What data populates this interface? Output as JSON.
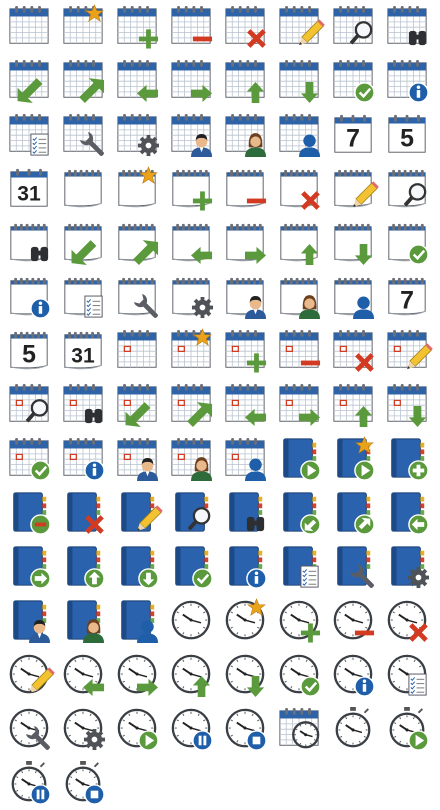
{
  "sheet": {
    "columns": 8,
    "colors": {
      "calendar_header": "#2f63a8",
      "grid_line": "#b8c2cf",
      "outline": "#5a5f66",
      "green": "#5b9a3c",
      "red": "#d23a22",
      "orange": "#e9a21a",
      "blue": "#1f5ea8",
      "book_blue": "#2a62ad",
      "clock_face": "#ffffff",
      "clock_ring": "#3a3f45"
    },
    "icons": [
      {
        "base": "cal-grid",
        "overlay": ""
      },
      {
        "base": "cal-grid",
        "overlay": "star"
      },
      {
        "base": "cal-grid",
        "overlay": "plus"
      },
      {
        "base": "cal-grid",
        "overlay": "minus"
      },
      {
        "base": "cal-grid",
        "overlay": "x"
      },
      {
        "base": "cal-grid",
        "overlay": "pencil"
      },
      {
        "base": "cal-grid",
        "overlay": "magnifier"
      },
      {
        "base": "cal-grid",
        "overlay": "binoculars"
      },
      {
        "base": "cal-grid",
        "overlay": "arrow-down-left"
      },
      {
        "base": "cal-grid",
        "overlay": "arrow-up-right"
      },
      {
        "base": "cal-grid",
        "overlay": "arrow-left"
      },
      {
        "base": "cal-grid",
        "overlay": "arrow-right"
      },
      {
        "base": "cal-grid",
        "overlay": "arrow-up"
      },
      {
        "base": "cal-grid",
        "overlay": "arrow-down"
      },
      {
        "base": "cal-grid",
        "overlay": "check"
      },
      {
        "base": "cal-grid",
        "overlay": "info"
      },
      {
        "base": "cal-grid",
        "overlay": "checklist"
      },
      {
        "base": "cal-grid",
        "overlay": "wrench"
      },
      {
        "base": "cal-grid",
        "overlay": "gear"
      },
      {
        "base": "cal-grid",
        "overlay": "person-man"
      },
      {
        "base": "cal-grid",
        "overlay": "person-woman"
      },
      {
        "base": "cal-grid",
        "overlay": "person-silhouette"
      },
      {
        "base": "cal-day",
        "overlay": "",
        "label": "7"
      },
      {
        "base": "cal-day",
        "overlay": "",
        "label": "5"
      },
      {
        "base": "cal-day",
        "overlay": "",
        "label": "31"
      },
      {
        "base": "cal-page",
        "overlay": ""
      },
      {
        "base": "cal-page",
        "overlay": "star"
      },
      {
        "base": "cal-page",
        "overlay": "plus"
      },
      {
        "base": "cal-page",
        "overlay": "minus"
      },
      {
        "base": "cal-page",
        "overlay": "x"
      },
      {
        "base": "cal-page",
        "overlay": "pencil"
      },
      {
        "base": "cal-page",
        "overlay": "magnifier"
      },
      {
        "base": "cal-page",
        "overlay": "binoculars"
      },
      {
        "base": "cal-page",
        "overlay": "arrow-down-left"
      },
      {
        "base": "cal-page",
        "overlay": "arrow-up-right"
      },
      {
        "base": "cal-page",
        "overlay": "arrow-left"
      },
      {
        "base": "cal-page",
        "overlay": "arrow-right"
      },
      {
        "base": "cal-page",
        "overlay": "arrow-up"
      },
      {
        "base": "cal-page",
        "overlay": "arrow-down"
      },
      {
        "base": "cal-page",
        "overlay": "check"
      },
      {
        "base": "cal-page",
        "overlay": "info"
      },
      {
        "base": "cal-page",
        "overlay": "checklist"
      },
      {
        "base": "cal-page",
        "overlay": "wrench"
      },
      {
        "base": "cal-page",
        "overlay": "gear"
      },
      {
        "base": "cal-page",
        "overlay": "person-man"
      },
      {
        "base": "cal-page",
        "overlay": "person-woman"
      },
      {
        "base": "cal-page",
        "overlay": "person-silhouette"
      },
      {
        "base": "cal-page-day",
        "overlay": "",
        "label": "7"
      },
      {
        "base": "cal-page-day",
        "overlay": "",
        "label": "5"
      },
      {
        "base": "cal-page-day",
        "overlay": "",
        "label": "31"
      },
      {
        "base": "cal-mark",
        "overlay": ""
      },
      {
        "base": "cal-mark",
        "overlay": "star"
      },
      {
        "base": "cal-mark",
        "overlay": "plus"
      },
      {
        "base": "cal-mark",
        "overlay": "minus"
      },
      {
        "base": "cal-mark",
        "overlay": "x"
      },
      {
        "base": "cal-mark",
        "overlay": "pencil"
      },
      {
        "base": "cal-mark",
        "overlay": "magnifier"
      },
      {
        "base": "cal-mark",
        "overlay": "binoculars"
      },
      {
        "base": "cal-mark",
        "overlay": "arrow-down-left"
      },
      {
        "base": "cal-mark",
        "overlay": "arrow-up-right"
      },
      {
        "base": "cal-mark",
        "overlay": "arrow-left"
      },
      {
        "base": "cal-mark",
        "overlay": "arrow-right"
      },
      {
        "base": "cal-mark",
        "overlay": "arrow-up"
      },
      {
        "base": "cal-mark",
        "overlay": "arrow-down"
      },
      {
        "base": "cal-mark",
        "overlay": "check"
      },
      {
        "base": "cal-mark",
        "overlay": "info"
      },
      {
        "base": "cal-mark",
        "overlay": "person-man"
      },
      {
        "base": "cal-mark",
        "overlay": "person-woman"
      },
      {
        "base": "cal-mark",
        "overlay": "person-silhouette"
      },
      {
        "base": "book",
        "overlay": "play"
      },
      {
        "base": "book",
        "overlay": "star-play"
      },
      {
        "base": "book",
        "overlay": "plus-round"
      },
      {
        "base": "book",
        "overlay": "minus-round"
      },
      {
        "base": "book",
        "overlay": "x"
      },
      {
        "base": "book",
        "overlay": "pencil"
      },
      {
        "base": "book",
        "overlay": "magnifier"
      },
      {
        "base": "book",
        "overlay": "binoculars"
      },
      {
        "base": "book",
        "overlay": "arrow-down-left-round"
      },
      {
        "base": "book",
        "overlay": "arrow-up-right-round"
      },
      {
        "base": "book",
        "overlay": "arrow-left-round"
      },
      {
        "base": "book",
        "overlay": "arrow-right-round"
      },
      {
        "base": "book",
        "overlay": "arrow-up-round"
      },
      {
        "base": "book",
        "overlay": "arrow-down-round"
      },
      {
        "base": "book",
        "overlay": "check"
      },
      {
        "base": "book",
        "overlay": "info"
      },
      {
        "base": "book",
        "overlay": "checklist"
      },
      {
        "base": "book",
        "overlay": "wrench"
      },
      {
        "base": "book",
        "overlay": "gear"
      },
      {
        "base": "book",
        "overlay": "person-man"
      },
      {
        "base": "book",
        "overlay": "person-woman"
      },
      {
        "base": "book",
        "overlay": "person-silhouette"
      },
      {
        "base": "clock",
        "overlay": ""
      },
      {
        "base": "clock",
        "overlay": "star"
      },
      {
        "base": "clock",
        "overlay": "plus"
      },
      {
        "base": "clock",
        "overlay": "minus"
      },
      {
        "base": "clock",
        "overlay": "x"
      },
      {
        "base": "clock",
        "overlay": "pencil"
      },
      {
        "base": "clock",
        "overlay": "arrow-left"
      },
      {
        "base": "clock",
        "overlay": "arrow-right"
      },
      {
        "base": "clock",
        "overlay": "arrow-up"
      },
      {
        "base": "clock",
        "overlay": "arrow-down"
      },
      {
        "base": "clock",
        "overlay": "check"
      },
      {
        "base": "clock",
        "overlay": "info"
      },
      {
        "base": "clock",
        "overlay": "checklist"
      },
      {
        "base": "clock",
        "overlay": "wrench"
      },
      {
        "base": "clock",
        "overlay": "gear"
      },
      {
        "base": "clock",
        "overlay": "play"
      },
      {
        "base": "clock",
        "overlay": "pause"
      },
      {
        "base": "clock",
        "overlay": "stop"
      },
      {
        "base": "cal-clock",
        "overlay": ""
      },
      {
        "base": "stopwatch",
        "overlay": ""
      },
      {
        "base": "stopwatch",
        "overlay": "play"
      },
      {
        "base": "stopwatch",
        "overlay": "pause"
      },
      {
        "base": "stopwatch",
        "overlay": "stop"
      }
    ]
  }
}
